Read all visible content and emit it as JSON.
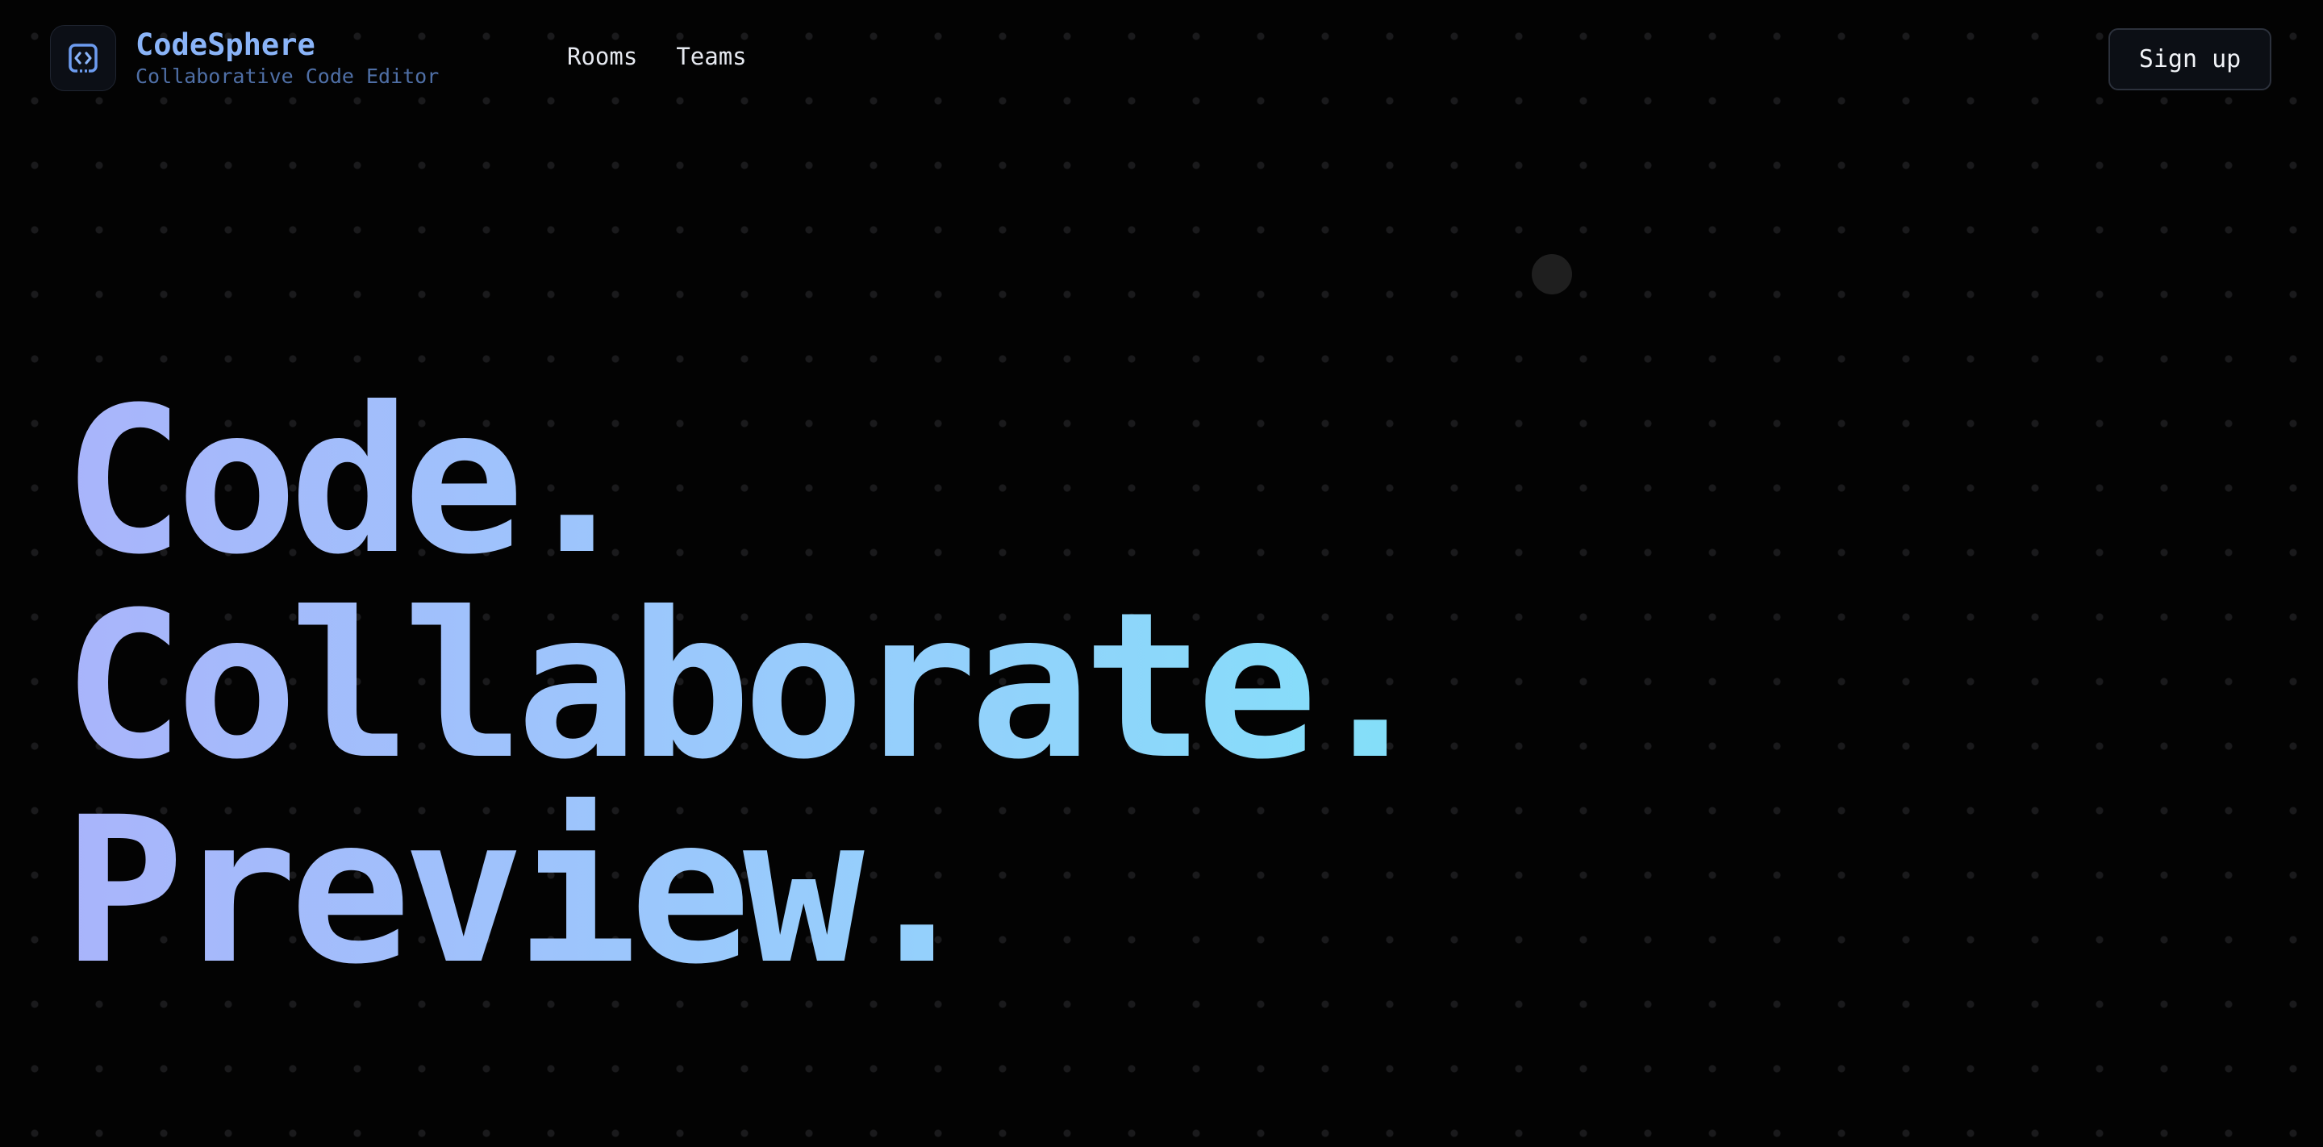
{
  "brand": {
    "name": "CodeSphere",
    "tagline": "Collaborative Code Editor",
    "logo_icon": "code-brackets-icon"
  },
  "nav": {
    "items": [
      {
        "label": "Rooms"
      },
      {
        "label": "Teams"
      }
    ]
  },
  "header": {
    "signup_label": "Sign up"
  },
  "hero": {
    "lines": [
      "Code.",
      "Collaborate.",
      "Preview."
    ]
  },
  "colors": {
    "background": "#030303",
    "brand_accent": "#8ab4f8",
    "gradient_start": "#a9b4fb",
    "gradient_end": "#7fe3f8"
  }
}
